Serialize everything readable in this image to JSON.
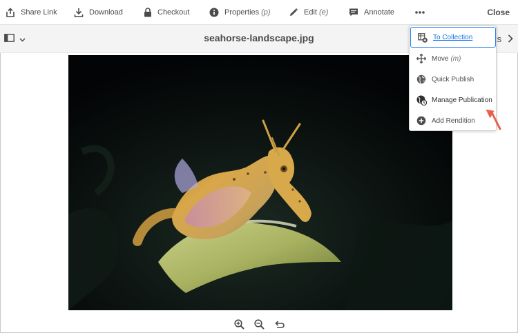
{
  "toolbar": {
    "items": [
      {
        "label": "Share Link",
        "icon": "share-icon"
      },
      {
        "label": "Download",
        "icon": "download-icon"
      },
      {
        "label": "Checkout",
        "icon": "lock-icon"
      },
      {
        "label": "Properties",
        "shortcut": "(p)",
        "icon": "info-icon"
      },
      {
        "label": "Edit",
        "shortcut": "(e)",
        "icon": "pencil-icon"
      },
      {
        "label": "Annotate",
        "icon": "comment-icon"
      }
    ],
    "more_icon": "more-icon",
    "close_label": "Close"
  },
  "subbar": {
    "file_title": "seahorse-landscape.jpg",
    "partial_label": "ts"
  },
  "menu": {
    "items": [
      {
        "label": "To Collection",
        "icon": "collection-add-icon",
        "state": "focused"
      },
      {
        "label": "Move",
        "shortcut": "(m)",
        "icon": "move-icon"
      },
      {
        "label": "Quick Publish",
        "icon": "globe-icon"
      },
      {
        "label": "Manage Publication",
        "icon": "globe-clock-icon"
      },
      {
        "label": "Add Rendition",
        "icon": "add-circle-icon"
      }
    ]
  },
  "colors": {
    "accent": "#1473e6",
    "annotation_arrow": "#e8604c",
    "preview_bg": "#050708"
  }
}
